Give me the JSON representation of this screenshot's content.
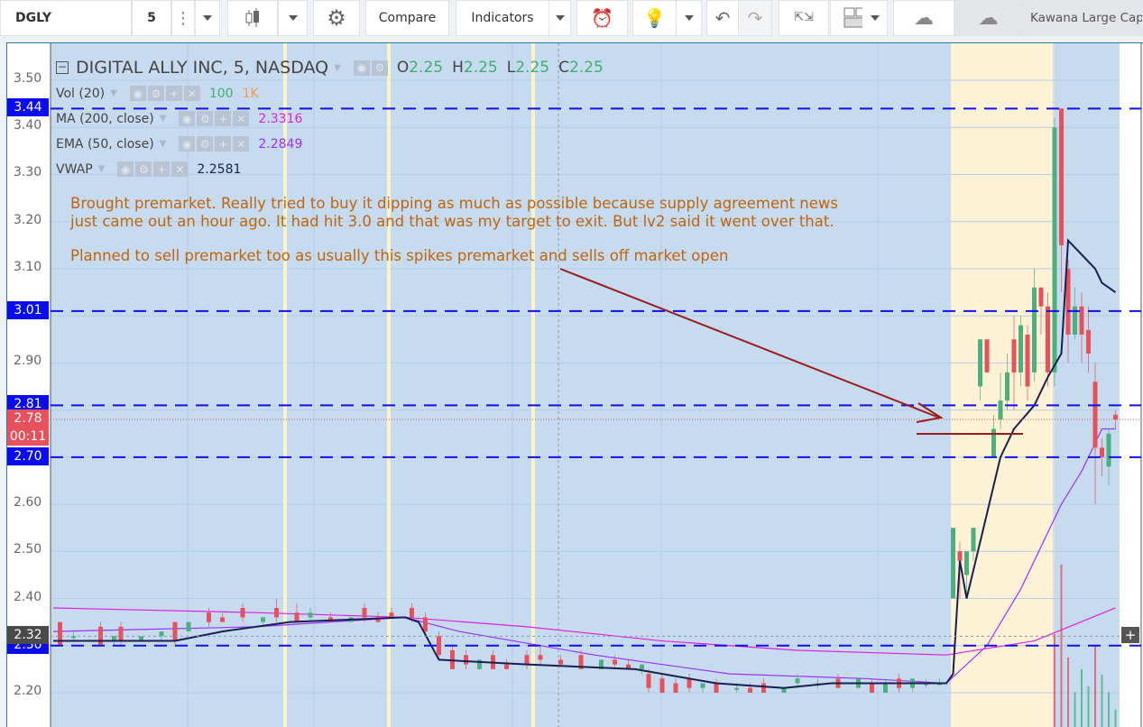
{
  "toolbar": {
    "symbol": "DGLY",
    "interval": "5",
    "compare_label": "Compare",
    "indicators_label": "Indicators",
    "watchlist_label": "Kawana Large Cap"
  },
  "legend": {
    "title": "DIGITAL ALLY INC, 5, NASDAQ",
    "ohlc": {
      "o_label": "O",
      "o": "2.25",
      "h_label": "H",
      "h": "2.25",
      "l_label": "L",
      "l": "2.25",
      "c_label": "C",
      "c": "2.25"
    },
    "vol": {
      "label": "Vol (20)",
      "v1": "100",
      "v2": "1K"
    },
    "ma": {
      "label": "MA (200, close)",
      "value": "2.3316"
    },
    "ema": {
      "label": "EMA (50, close)",
      "value": "2.2849"
    },
    "vwap": {
      "label": "VWAP",
      "value": "2.2581"
    }
  },
  "notes": {
    "line1": "Brought premarket.  Really tried to buy it dipping as much as possible because supply agreement news",
    "line2": "just came out an hour ago.  It had hit 3.0 and that was my target to exit.  But lv2 said it went over that.",
    "line3": "Planned to sell premarket too as usually this spikes premarket and sells off market open"
  },
  "price_axis": {
    "ticks": [
      "3.50",
      "3.40",
      "3.30",
      "3.20",
      "3.10",
      "2.90",
      "2.60",
      "2.50",
      "2.40",
      "2.20"
    ],
    "levels": [
      "3.44",
      "3.01",
      "2.81",
      "2.70",
      "2.30"
    ],
    "last_price": "2.78",
    "countdown": "00:11",
    "crosshair_price": "2.32"
  },
  "colors": {
    "up": "#4caf7d",
    "down": "#e8505b",
    "vwap": "#1b1f4f",
    "ma": "#e020e0",
    "ema": "#9b30ff",
    "level": "#1010ee",
    "note": "#c0650c",
    "arrow": "#9b1c1c",
    "bg": "#c6dbef",
    "premarket": "#fdf2d6"
  },
  "chart_data": {
    "type": "candlestick",
    "candles": [
      [
        1,
        2.35,
        2.35,
        2.3,
        2.3
      ],
      [
        3,
        2.32,
        2.33,
        2.31,
        2.32
      ],
      [
        7,
        2.34,
        2.35,
        2.3,
        2.3
      ],
      [
        9,
        2.31,
        2.32,
        2.3,
        2.32
      ],
      [
        10,
        2.34,
        2.35,
        2.3,
        2.31
      ],
      [
        13,
        2.31,
        2.32,
        2.31,
        2.32
      ],
      [
        16,
        2.32,
        2.33,
        2.31,
        2.33
      ],
      [
        18,
        2.35,
        2.35,
        2.3,
        2.31
      ],
      [
        20,
        2.33,
        2.35,
        2.33,
        2.35
      ],
      [
        23,
        2.37,
        2.38,
        2.34,
        2.35
      ],
      [
        25,
        2.36,
        2.37,
        2.35,
        2.35
      ],
      [
        28,
        2.38,
        2.39,
        2.35,
        2.36
      ],
      [
        31,
        2.35,
        2.36,
        2.34,
        2.36
      ],
      [
        33,
        2.38,
        2.4,
        2.35,
        2.36
      ],
      [
        36,
        2.37,
        2.39,
        2.35,
        2.35
      ],
      [
        38,
        2.36,
        2.38,
        2.35,
        2.37
      ],
      [
        41,
        2.36,
        2.37,
        2.35,
        2.35
      ],
      [
        44,
        2.35,
        2.36,
        2.35,
        2.36
      ],
      [
        46,
        2.38,
        2.39,
        2.35,
        2.36
      ],
      [
        48,
        2.36,
        2.37,
        2.35,
        2.35
      ],
      [
        50,
        2.37,
        2.38,
        2.36,
        2.36
      ],
      [
        53,
        2.38,
        2.39,
        2.35,
        2.36
      ],
      [
        55,
        2.36,
        2.37,
        2.32,
        2.33
      ],
      [
        57,
        2.32,
        2.33,
        2.27,
        2.28
      ],
      [
        59,
        2.29,
        2.3,
        2.25,
        2.25
      ],
      [
        61,
        2.28,
        2.29,
        2.25,
        2.26
      ],
      [
        63,
        2.25,
        2.27,
        2.25,
        2.27
      ],
      [
        65,
        2.28,
        2.29,
        2.25,
        2.25
      ],
      [
        67,
        2.26,
        2.27,
        2.25,
        2.25
      ],
      [
        70,
        2.28,
        2.29,
        2.25,
        2.26
      ],
      [
        72,
        2.28,
        2.3,
        2.26,
        2.27
      ],
      [
        75,
        2.27,
        2.28,
        2.26,
        2.26
      ],
      [
        78,
        2.28,
        2.29,
        2.25,
        2.25
      ],
      [
        81,
        2.25,
        2.27,
        2.25,
        2.27
      ],
      [
        83,
        2.27,
        2.28,
        2.25,
        2.26
      ],
      [
        85,
        2.26,
        2.27,
        2.25,
        2.25
      ],
      [
        87,
        2.25,
        2.26,
        2.24,
        2.26
      ],
      [
        88,
        2.24,
        2.25,
        2.2,
        2.21
      ],
      [
        90,
        2.23,
        2.24,
        2.2,
        2.2
      ],
      [
        92,
        2.22,
        2.23,
        2.2,
        2.2
      ],
      [
        94,
        2.23,
        2.24,
        2.2,
        2.21
      ],
      [
        96,
        2.21,
        2.22,
        2.2,
        2.22
      ],
      [
        98,
        2.22,
        2.23,
        2.2,
        2.2
      ],
      [
        101,
        2.21,
        2.22,
        2.2,
        2.21
      ],
      [
        103,
        2.21,
        2.22,
        2.2,
        2.2
      ],
      [
        105,
        2.22,
        2.23,
        2.2,
        2.2
      ],
      [
        108,
        2.2,
        2.21,
        2.2,
        2.21
      ],
      [
        110,
        2.22,
        2.24,
        2.21,
        2.23
      ],
      [
        113,
        2.22,
        2.23,
        2.21,
        2.22
      ],
      [
        116,
        2.23,
        2.24,
        2.21,
        2.21
      ],
      [
        119,
        2.21,
        2.23,
        2.21,
        2.23
      ],
      [
        121,
        2.22,
        2.23,
        2.2,
        2.2
      ],
      [
        123,
        2.2,
        2.23,
        2.2,
        2.22
      ],
      [
        125,
        2.23,
        2.24,
        2.2,
        2.21
      ],
      [
        127,
        2.21,
        2.23,
        2.2,
        2.23
      ],
      [
        129,
        2.22,
        2.23,
        2.21,
        2.22
      ],
      [
        131,
        2.22,
        2.23,
        2.22,
        2.22
      ],
      [
        133,
        2.4,
        2.55,
        2.4,
        2.55
      ],
      [
        134,
        2.5,
        2.52,
        2.4,
        2.48
      ],
      [
        135,
        2.45,
        2.5,
        2.4,
        2.5
      ],
      [
        136,
        2.5,
        2.55,
        2.48,
        2.55
      ],
      [
        137,
        2.85,
        2.95,
        2.82,
        2.95
      ],
      [
        138,
        2.95,
        2.95,
        2.88,
        2.88
      ],
      [
        139,
        2.7,
        2.79,
        2.7,
        2.76
      ],
      [
        140,
        2.78,
        2.88,
        2.76,
        2.82
      ],
      [
        141,
        2.82,
        2.92,
        2.8,
        2.88
      ],
      [
        142,
        2.95,
        3.0,
        2.8,
        2.88
      ],
      [
        143,
        2.88,
        3.0,
        2.85,
        2.98
      ],
      [
        144,
        2.96,
        2.98,
        2.82,
        2.85
      ],
      [
        145,
        2.88,
        3.1,
        2.86,
        3.06
      ],
      [
        146,
        3.06,
        3.06,
        2.96,
        3.02
      ],
      [
        147,
        3.02,
        3.05,
        2.85,
        2.88
      ],
      [
        148,
        2.88,
        3.42,
        2.85,
        3.4
      ],
      [
        149,
        3.44,
        3.44,
        3.05,
        3.15
      ],
      [
        150,
        3.1,
        3.12,
        2.9,
        2.96
      ],
      [
        151,
        2.96,
        3.06,
        2.95,
        3.02
      ],
      [
        152,
        3.02,
        3.05,
        2.9,
        2.96
      ],
      [
        153,
        2.97,
        3.02,
        2.88,
        2.92
      ],
      [
        154,
        2.86,
        2.9,
        2.6,
        2.72
      ],
      [
        155,
        2.72,
        2.74,
        2.66,
        2.7
      ],
      [
        156,
        2.68,
        2.76,
        2.64,
        2.75
      ],
      [
        157,
        2.79,
        2.8,
        2.76,
        2.78
      ]
    ],
    "vwap": [
      [
        0,
        2.31
      ],
      [
        18,
        2.31
      ],
      [
        25,
        2.33
      ],
      [
        35,
        2.35
      ],
      [
        52,
        2.36
      ],
      [
        54,
        2.35
      ],
      [
        57,
        2.27
      ],
      [
        70,
        2.26
      ],
      [
        86,
        2.25
      ],
      [
        98,
        2.22
      ],
      [
        108,
        2.21
      ],
      [
        115,
        2.22
      ],
      [
        132,
        2.22
      ],
      [
        133,
        2.24
      ],
      [
        134,
        2.48
      ],
      [
        135,
        2.4
      ],
      [
        138,
        2.58
      ],
      [
        140,
        2.7
      ],
      [
        142,
        2.76
      ],
      [
        145,
        2.81
      ],
      [
        147,
        2.87
      ],
      [
        149,
        2.92
      ],
      [
        150,
        3.16
      ],
      [
        152,
        3.13
      ],
      [
        154,
        3.1
      ],
      [
        155,
        3.07
      ],
      [
        157,
        3.05
      ]
    ],
    "ma200": [
      [
        0,
        2.38
      ],
      [
        30,
        2.37
      ],
      [
        52,
        2.36
      ],
      [
        70,
        2.34
      ],
      [
        90,
        2.31
      ],
      [
        110,
        2.29
      ],
      [
        132,
        2.28
      ],
      [
        145,
        2.31
      ],
      [
        157,
        2.38
      ]
    ],
    "ema50": [
      [
        0,
        2.33
      ],
      [
        30,
        2.34
      ],
      [
        52,
        2.36
      ],
      [
        60,
        2.33
      ],
      [
        80,
        2.28
      ],
      [
        100,
        2.24
      ],
      [
        120,
        2.23
      ],
      [
        132,
        2.22
      ],
      [
        138,
        2.3
      ],
      [
        143,
        2.42
      ],
      [
        149,
        2.6
      ],
      [
        152,
        2.67
      ],
      [
        155,
        2.76
      ],
      [
        157,
        2.76
      ]
    ],
    "volume": [
      [
        148,
        800
      ],
      [
        149,
        1400
      ],
      [
        150,
        600
      ],
      [
        151,
        300
      ],
      [
        152,
        500
      ],
      [
        153,
        350
      ],
      [
        154,
        700
      ],
      [
        155,
        450
      ],
      [
        156,
        300
      ],
      [
        157,
        150
      ]
    ],
    "ylim": [
      2.15,
      3.55
    ]
  }
}
